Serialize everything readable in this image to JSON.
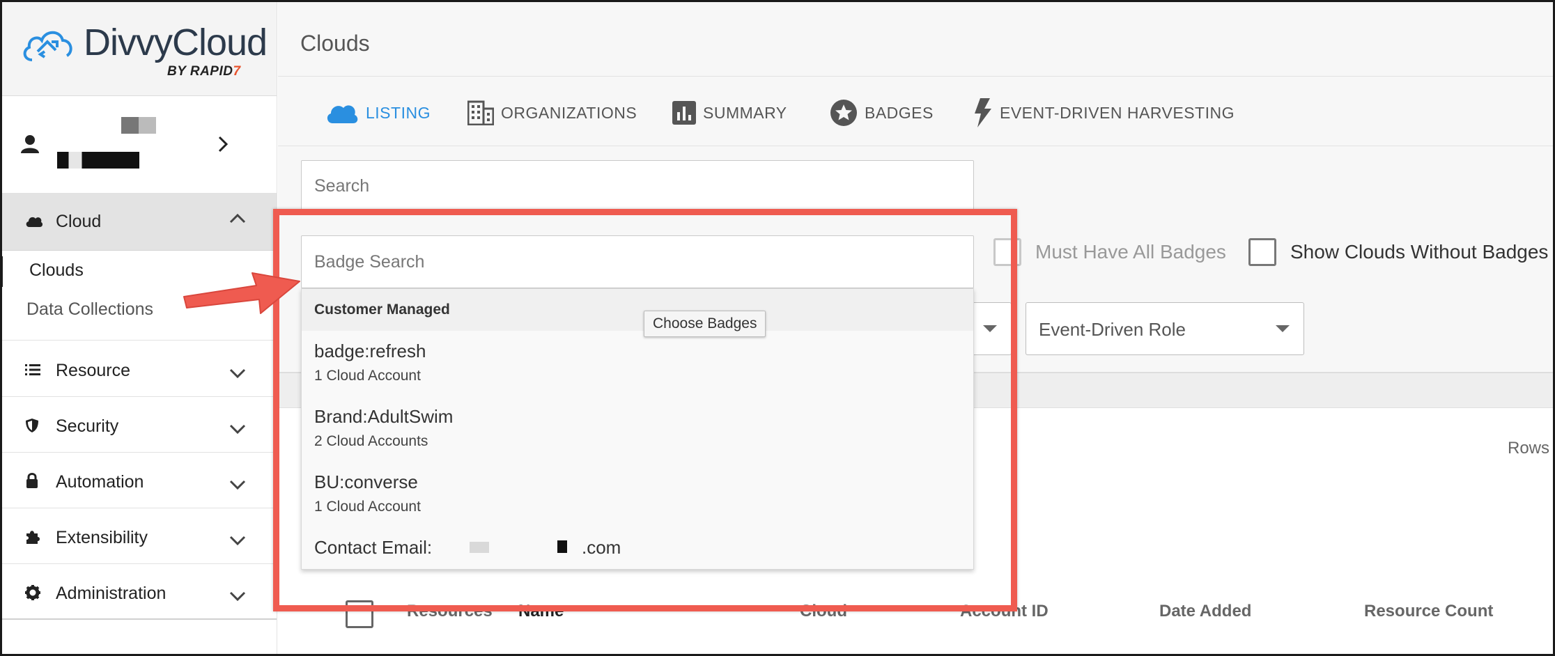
{
  "brand": {
    "name": "DivvyCloud",
    "by": "BY",
    "rapid": "RAPID",
    "seven": "7"
  },
  "colors": {
    "accent": "#2a8fe0",
    "highlight": "#ef5b50",
    "logo_text": "#2c3a4b"
  },
  "sidebar": {
    "cloud": {
      "label": "Cloud",
      "icon": "cloud-icon"
    },
    "cloud_sub": [
      {
        "label": "Clouds"
      },
      {
        "label": "Data Collections"
      }
    ],
    "items": [
      {
        "label": "Resource",
        "icon": "list-icon"
      },
      {
        "label": "Security",
        "icon": "shield-icon"
      },
      {
        "label": "Automation",
        "icon": "lock-icon"
      },
      {
        "label": "Extensibility",
        "icon": "puzzle-icon"
      },
      {
        "label": "Administration",
        "icon": "gear-icon"
      }
    ]
  },
  "header": {
    "title": "Clouds"
  },
  "tabs": [
    {
      "label": "LISTING",
      "icon": "cloud-icon"
    },
    {
      "label": "ORGANIZATIONS",
      "icon": "building-icon"
    },
    {
      "label": "SUMMARY",
      "icon": "bar-chart-icon"
    },
    {
      "label": "BADGES",
      "icon": "star-badge-icon"
    },
    {
      "label": "EVENT-DRIVEN HARVESTING",
      "icon": "lightning-icon"
    }
  ],
  "filters": {
    "search_placeholder": "Search",
    "badge_search_placeholder": "Badge Search",
    "must_have_all": "Must Have All Badges",
    "show_without": "Show Clouds Without Badges",
    "event_driven_role": "Event-Driven Role"
  },
  "dropdown": {
    "group": "Customer Managed",
    "tooltip": "Choose Badges",
    "items": [
      {
        "title": "badge:refresh",
        "sub": "1 Cloud Account"
      },
      {
        "title": "Brand:AdultSwim",
        "sub": "2 Cloud Accounts"
      },
      {
        "title": "BU:converse",
        "sub": "1 Cloud Account"
      }
    ],
    "last_item_prefix": "Contact Email:",
    "last_item_suffix": ".com"
  },
  "table": {
    "rows_label": "Rows p",
    "headers": [
      "Resources",
      "Name",
      "Cloud",
      "Account ID",
      "Date Added",
      "Resource Count"
    ]
  }
}
